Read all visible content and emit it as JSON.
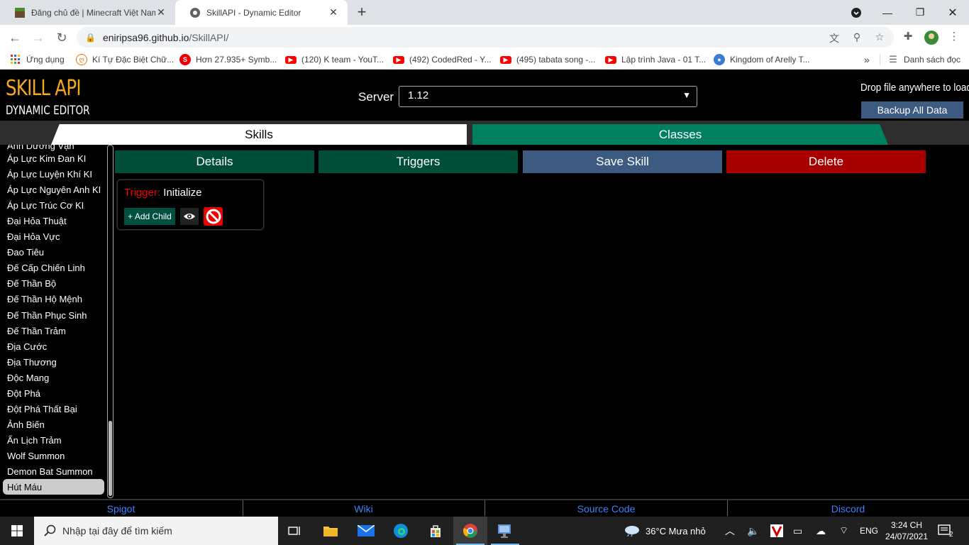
{
  "browser": {
    "tabs": [
      {
        "title": "Đăng chủ đề | Minecraft Việt Nam",
        "active": false
      },
      {
        "title": "SkillAPI - Dynamic Editor",
        "active": true
      }
    ],
    "url_host": "eniripsa96.github.io",
    "url_path": "/SkillAPI/",
    "bookmarks": [
      {
        "label": "Ứng dụng",
        "icon": "apps-grid-icon"
      },
      {
        "label": "Kí Tự Đặc Biệt Chữ...",
        "icon": "special-chars-icon"
      },
      {
        "label": "Hơn 27.935+ Symb...",
        "icon": "symbols-s-icon"
      },
      {
        "label": "(120) K team - YouT...",
        "icon": "youtube-icon"
      },
      {
        "label": "(492) CodedRed - Y...",
        "icon": "youtube-icon"
      },
      {
        "label": "(495) tabata song -...",
        "icon": "youtube-icon"
      },
      {
        "label": "Lập trình Java - 01 T...",
        "icon": "youtube-icon"
      },
      {
        "label": "Kingdom of Arelly T...",
        "icon": "globe-icon"
      }
    ],
    "reading_list": "Danh sách đọc"
  },
  "header": {
    "logo_line1": "SKILL API",
    "logo_line2": "DYNAMIC EDITOR",
    "server_label": "Server",
    "server_value": "1.12",
    "drop_text": "Drop file anywhere to load",
    "backup_label": "Backup All Data"
  },
  "tabs": {
    "skills": "Skills",
    "classes": "Classes"
  },
  "sidebar": {
    "partial_top": "Ánh Dương Vạn",
    "items": [
      "Áp Lực Kim Đan KI",
      "Áp Lực Luyện Khí KI",
      "Áp Lực Nguyên Anh KI",
      "Áp Lực Trúc Cơ KI",
      "Đại Hỏa Thuật",
      "Đại Hỏa Vực",
      "Đao Tiêu",
      "Đế Cấp Chiến Linh",
      "Đế Thần Bộ",
      "Đế Thần Hộ Mệnh",
      "Đế Thần Phục Sinh",
      "Đế Thần Trảm",
      "Địa Cước",
      "Địa Thương",
      "Độc Mang",
      "Đột Phá",
      "Đột Phá Thất Bại",
      "Ảnh Biến",
      "Ẩn Lịch Trảm",
      "Wolf Summon",
      "Demon Bat Summon",
      "Hút Máu"
    ],
    "selected": "Hút Máu"
  },
  "actions": {
    "details": "Details",
    "triggers": "Triggers",
    "save": "Save Skill",
    "delete": "Delete"
  },
  "trigger": {
    "label": "Trigger:",
    "name": "Initialize",
    "add_child": "+ Add Child"
  },
  "footer": {
    "links": [
      "Spigot",
      "Wiki",
      "Source Code",
      "Discord"
    ]
  },
  "taskbar": {
    "search_placeholder": "Nhập tại đây để tìm kiếm",
    "weather": "36°C  Mưa nhỏ",
    "lang": "ENG",
    "time": "3:24 CH",
    "date": "24/07/2021",
    "notifications": "2"
  },
  "colors": {
    "logo_orange": "#f5a623",
    "classes_green": "#008060",
    "details_green": "#004d38",
    "save_blue": "#3d5a80",
    "delete_red": "#a80000",
    "footer_link": "#3b82f6"
  }
}
